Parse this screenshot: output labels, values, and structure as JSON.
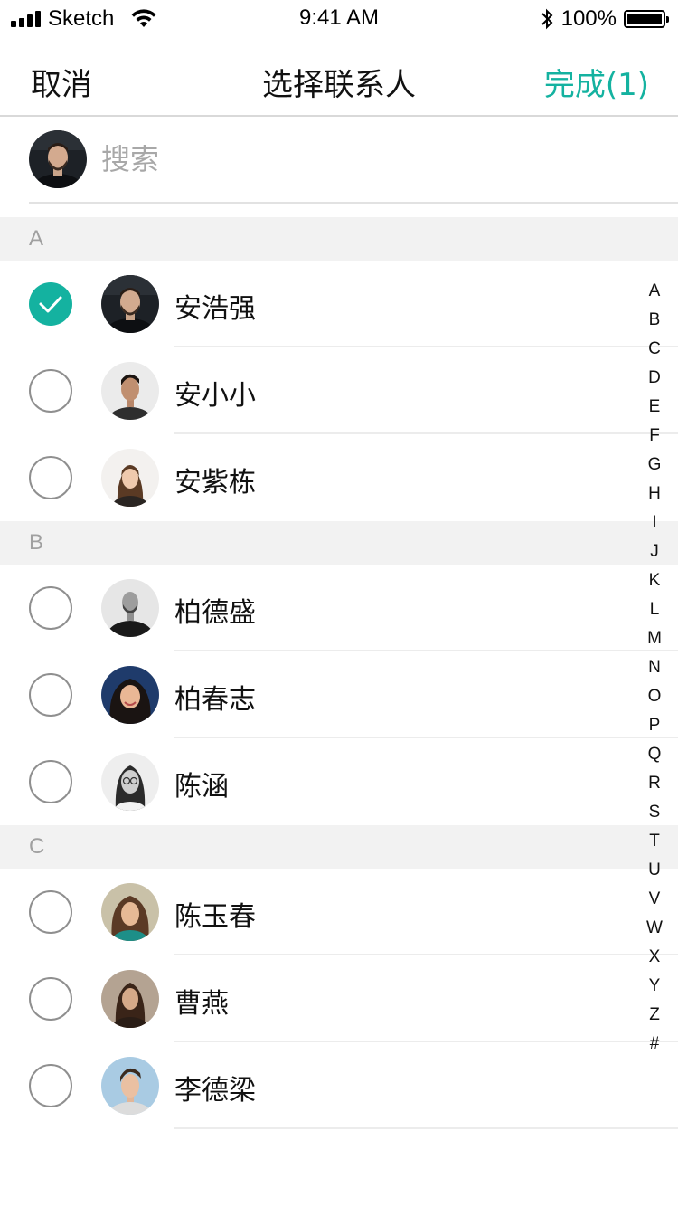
{
  "status_bar": {
    "carrier": "Sketch",
    "time": "9:41 AM",
    "battery_percent": "100%",
    "battery_level": 1.0,
    "icons": [
      "signal-icon",
      "wifi-icon",
      "bluetooth-icon",
      "battery-icon"
    ]
  },
  "nav": {
    "cancel_label": "取消",
    "title": "选择联系人",
    "done_label": "完成(1)"
  },
  "search": {
    "placeholder": "搜索"
  },
  "colors": {
    "accent": "#14b2a0",
    "section_bg": "#f2f2f2",
    "checkbox_border": "#8f8f8f"
  },
  "sections": [
    {
      "letter": "A",
      "contacts": [
        {
          "name": "安浩强",
          "checked": true
        },
        {
          "name": "安小小",
          "checked": false
        },
        {
          "name": "安紫栋",
          "checked": false
        }
      ]
    },
    {
      "letter": "B",
      "contacts": [
        {
          "name": "柏德盛",
          "checked": false
        },
        {
          "name": "柏春志",
          "checked": false
        },
        {
          "name": "陈涵",
          "checked": false
        }
      ]
    },
    {
      "letter": "C",
      "contacts": [
        {
          "name": "陈玉春",
          "checked": false
        },
        {
          "name": "曹燕",
          "checked": false
        },
        {
          "name": "李德梁",
          "checked": false
        }
      ]
    }
  ],
  "index_letters": [
    "A",
    "B",
    "C",
    "D",
    "E",
    "F",
    "G",
    "H",
    "I",
    "J",
    "K",
    "L",
    "M",
    "N",
    "O",
    "P",
    "Q",
    "R",
    "S",
    "T",
    "U",
    "V",
    "W",
    "X",
    "Y",
    "Z",
    "#"
  ]
}
